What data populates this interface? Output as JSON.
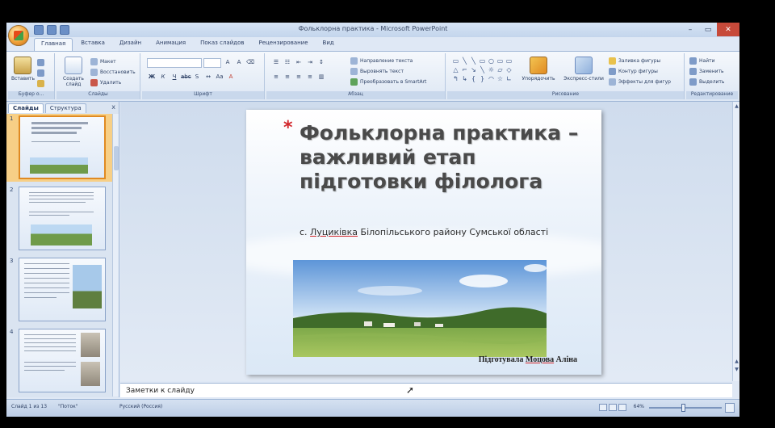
{
  "window": {
    "title": "Фольклорна практика - Microsoft PowerPoint",
    "controls": [
      "–",
      "▭",
      "✕"
    ]
  },
  "ribbon": {
    "tabs": [
      "Главная",
      "Вставка",
      "Дизайн",
      "Анимация",
      "Показ слайдов",
      "Рецензирование",
      "Вид"
    ],
    "active_tab": "Главная",
    "groups": {
      "clipboard": {
        "label": "Буфер о...",
        "paste": "Вставить"
      },
      "slides": {
        "label": "Слайды",
        "new_slide": "Создать слайд",
        "layout": "Макет",
        "reset": "Восстановить",
        "delete": "Удалить"
      },
      "font": {
        "label": "Шрифт"
      },
      "paragraph": {
        "label": "Абзац",
        "text_direction": "Направление текста",
        "align_text": "Выровнять текст",
        "smartart": "Преобразовать в SmartArt"
      },
      "drawing": {
        "label": "Рисование",
        "arrange": "Упорядочить",
        "quick_styles": "Экспресс-стили",
        "shape_fill": "Заливка фигуры",
        "shape_outline": "Контур фигуры",
        "shape_effects": "Эффекты для фигур"
      },
      "editing": {
        "label": "Редактирование",
        "find": "Найти",
        "replace": "Заменить",
        "select": "Выделить"
      }
    },
    "shape_symbols": [
      "▭",
      "╲",
      "╲",
      "▭",
      "○",
      "▭",
      "▭",
      "△",
      "⌐",
      "↘",
      "╲",
      "☼",
      "▱",
      "◇",
      "↰",
      "↳",
      "{",
      "}",
      "◠",
      "☆",
      "∟"
    ]
  },
  "left_panel": {
    "tabs": [
      "Слайды",
      "Структура"
    ],
    "active_tab": "Слайды",
    "close": "x",
    "thumbnails": [
      {
        "number": "1",
        "selected": true
      },
      {
        "number": "2",
        "selected": false
      },
      {
        "number": "3",
        "selected": false
      },
      {
        "number": "4",
        "selected": false
      }
    ]
  },
  "slide": {
    "bullet": "*",
    "title": "Фольклорна практика – важливий етап підготовки філолога",
    "subtitle_prefix": "с. ",
    "subtitle_village": "Луциківка",
    "subtitle_rest": " Білопільського району Сумської області",
    "author_prefix": "Підготувала ",
    "author_name": "Моцова",
    "author_suffix": " Аліна"
  },
  "notes": {
    "placeholder": "Заметки к слайду"
  },
  "statusbar": {
    "slide_info": "Слайд 1 из 13",
    "theme": "\"Поток\"",
    "language": "Русский (Россия)",
    "zoom": "64%"
  },
  "colors": {
    "accent_red": "#d2272c",
    "ribbon": "#dde7f4",
    "selection": "#f7cf86"
  }
}
